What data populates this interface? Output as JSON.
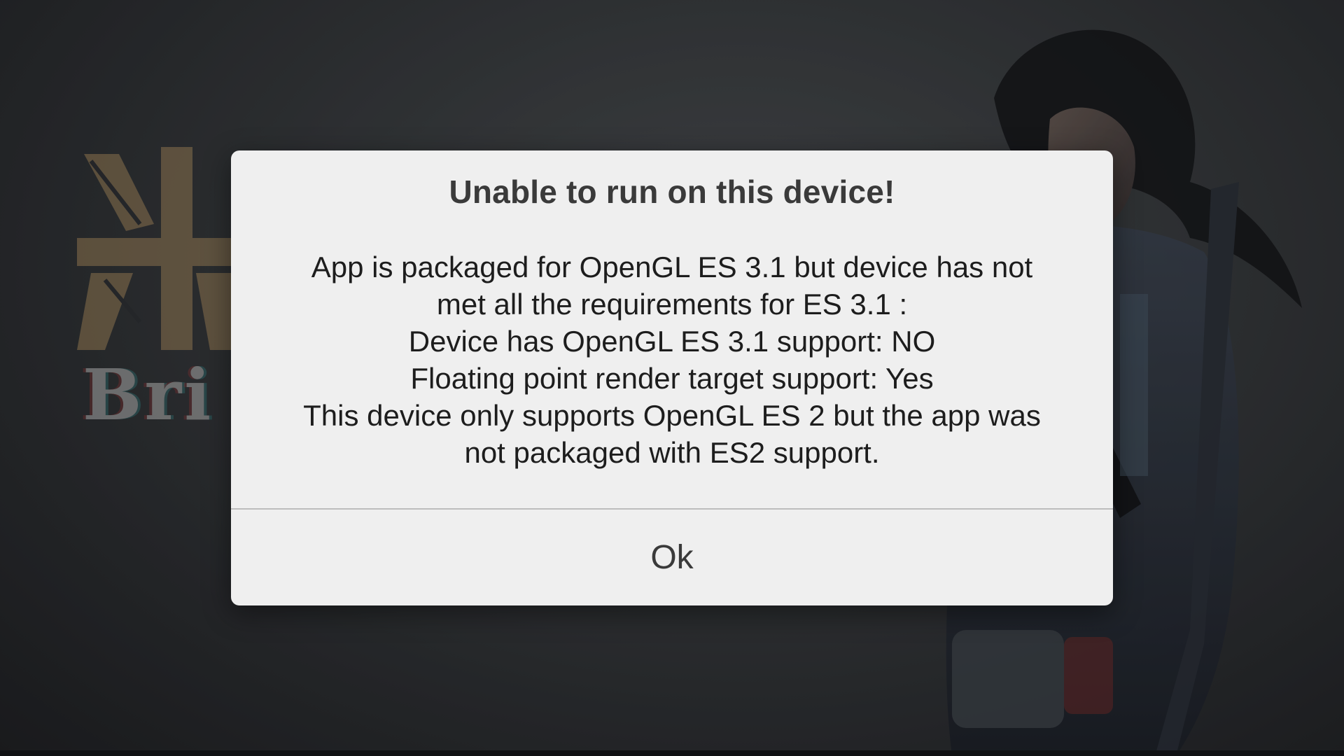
{
  "dialog": {
    "title": "Unable to run on this device!",
    "message_lines": [
      "App is packaged for OpenGL ES 3.1 but device has not",
      "met all the requirements for ES 3.1 :",
      "Device has OpenGL ES 3.1 support: NO",
      "Floating point render target support: Yes",
      "This device only supports OpenGL ES 2 but the app was",
      "not packaged with ES2 support."
    ],
    "ok_label": "Ok"
  },
  "background": {
    "logo_text": "Bri"
  },
  "colors": {
    "dialog_bg": "#efefef",
    "title_text": "#3a3a3a",
    "body_text": "#1d1d1d",
    "divider": "#bdbdbd",
    "logo_accent": "#a88a5e"
  }
}
